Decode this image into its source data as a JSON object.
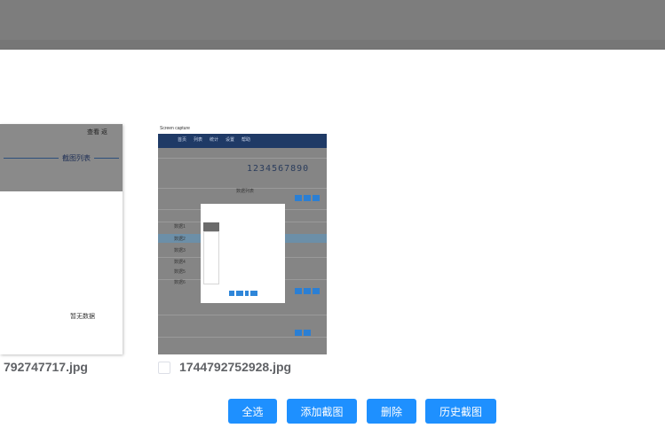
{
  "images": [
    {
      "filename": "792747717.jpg",
      "thumb": {
        "top_right_text": "查看  返",
        "title": "截图列表",
        "middle_text": "暂无数据"
      }
    },
    {
      "filename": "1744792752928.jpg",
      "thumb": {
        "window_title": "Screen capture",
        "nav_items": [
          "首页",
          "列表",
          "统计",
          "设置",
          "帮助"
        ],
        "big_text": "1234567890",
        "table_label": "数据列表",
        "rows": [
          "数据1",
          "数据2",
          "数据3",
          "数据4",
          "数据5",
          "数据6"
        ]
      }
    }
  ],
  "buttons": {
    "select_all": "全选",
    "add_screenshot": "添加截图",
    "delete": "删除",
    "history": "历史截图"
  },
  "colors": {
    "primary": "#1e90ff",
    "topbar": "#7d7d7d",
    "caption": "#606266"
  }
}
